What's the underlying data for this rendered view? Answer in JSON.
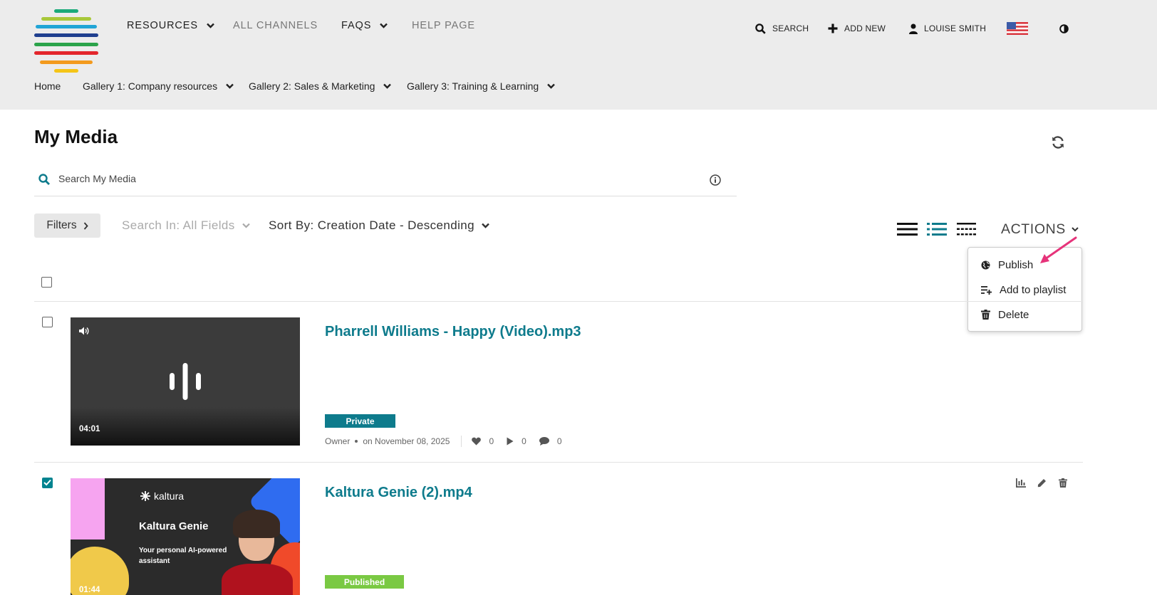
{
  "header": {
    "nav": [
      {
        "label": "RESOURCES",
        "has_dropdown": true
      },
      {
        "label": "ALL CHANNELS",
        "has_dropdown": false
      },
      {
        "label": "FAQS",
        "has_dropdown": true
      },
      {
        "label": "HELP PAGE",
        "has_dropdown": false
      }
    ],
    "search_label": "SEARCH",
    "add_new_label": "ADD NEW",
    "user_label": "LOUISE SMITH",
    "language_icon": "us-flag-icon",
    "contrast_icon": "contrast-icon",
    "subnav": [
      {
        "label": "Home",
        "has_dropdown": false
      },
      {
        "label": "Gallery 1: Company resources",
        "has_dropdown": true
      },
      {
        "label": "Gallery 2: Sales & Marketing",
        "has_dropdown": true
      },
      {
        "label": "Gallery 3: Training & Learning",
        "has_dropdown": true
      }
    ]
  },
  "page": {
    "title": "My Media",
    "search_placeholder": "Search My Media",
    "filters_label": "Filters",
    "search_in_label": "Search In: All Fields",
    "sort_by_label": "Sort By: Creation Date - Descending",
    "actions_label": "ACTIONS"
  },
  "actions_menu": [
    {
      "label": "Publish",
      "icon": "globe-icon"
    },
    {
      "label": "Add to playlist",
      "icon": "add-to-playlist-icon"
    },
    {
      "label": "Delete",
      "icon": "trash-icon"
    }
  ],
  "media": [
    {
      "title": "Pharrell Williams - Happy (Video).mp3",
      "duration": "04:01",
      "status": "Private",
      "status_color": "#0e7b8c",
      "owner": "Owner",
      "date": "on November 08, 2025",
      "likes": "0",
      "plays": "0",
      "comments": "0",
      "checked": false
    },
    {
      "title": "Kaltura Genie (2).mp4",
      "duration": "01:44",
      "status": "Published",
      "status_color": "#7ac943",
      "checked": true,
      "thumb_brand": "kaltura",
      "thumb_title": "Kaltura Genie",
      "thumb_sub_1": "Your personal AI-powered",
      "thumb_sub_2": "assistant"
    }
  ],
  "colors": {
    "accent": "#0e7b8c",
    "header_bg": "#ececec",
    "arrow": "#e6337a"
  }
}
